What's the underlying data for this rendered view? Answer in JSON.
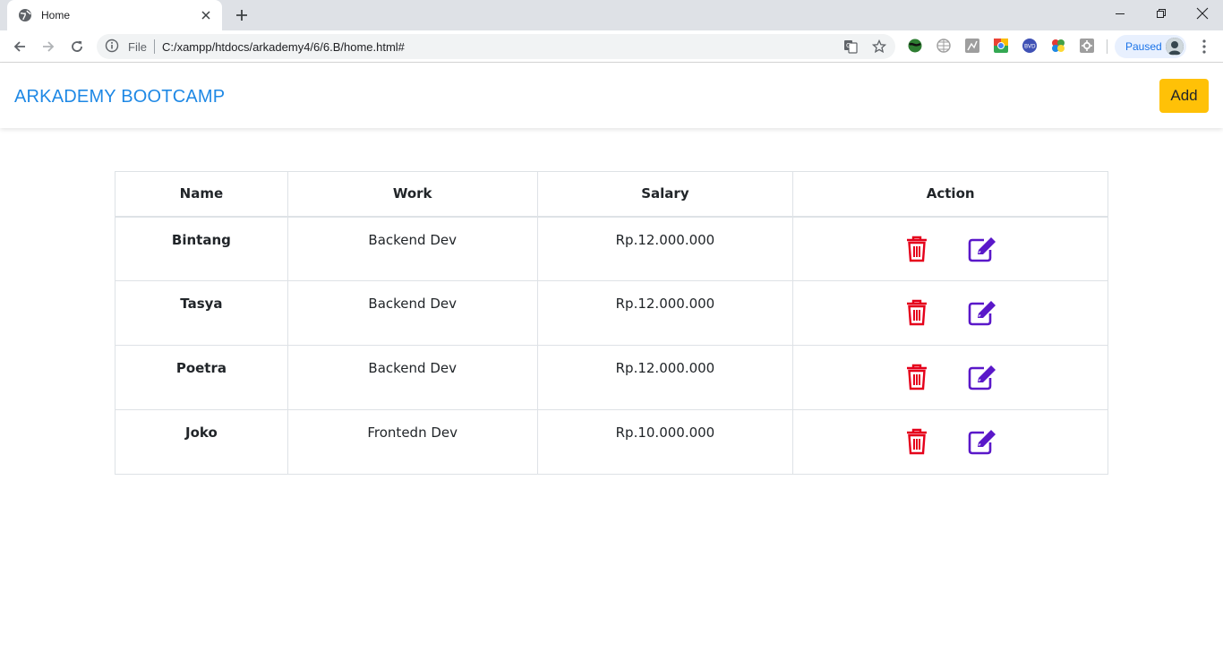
{
  "browser": {
    "tab_title": "Home",
    "omnibox": {
      "scheme_label": "File",
      "url": "C:/xampp/htdocs/arkademy4/6/6.B/home.html#"
    },
    "profile_label": "Paused"
  },
  "navbar": {
    "brand": "ARKADEMY BOOTCAMP",
    "add_label": "Add"
  },
  "colors": {
    "brand": "#1e88e5",
    "add_button": "#ffc107",
    "delete_icon": "#e5001b",
    "edit_icon": "#5a18c9"
  },
  "table": {
    "headers": [
      "Name",
      "Work",
      "Salary",
      "Action"
    ],
    "rows": [
      {
        "name": "Bintang",
        "work": "Backend Dev",
        "salary": "Rp.12.000.000"
      },
      {
        "name": "Tasya",
        "work": "Backend Dev",
        "salary": "Rp.12.000.000"
      },
      {
        "name": "Poetra",
        "work": "Backend Dev",
        "salary": "Rp.12.000.000"
      },
      {
        "name": "Joko",
        "work": "Frontedn Dev",
        "salary": "Rp.10.000.000"
      }
    ],
    "row_actions": [
      "trash-icon",
      "edit-icon"
    ]
  }
}
